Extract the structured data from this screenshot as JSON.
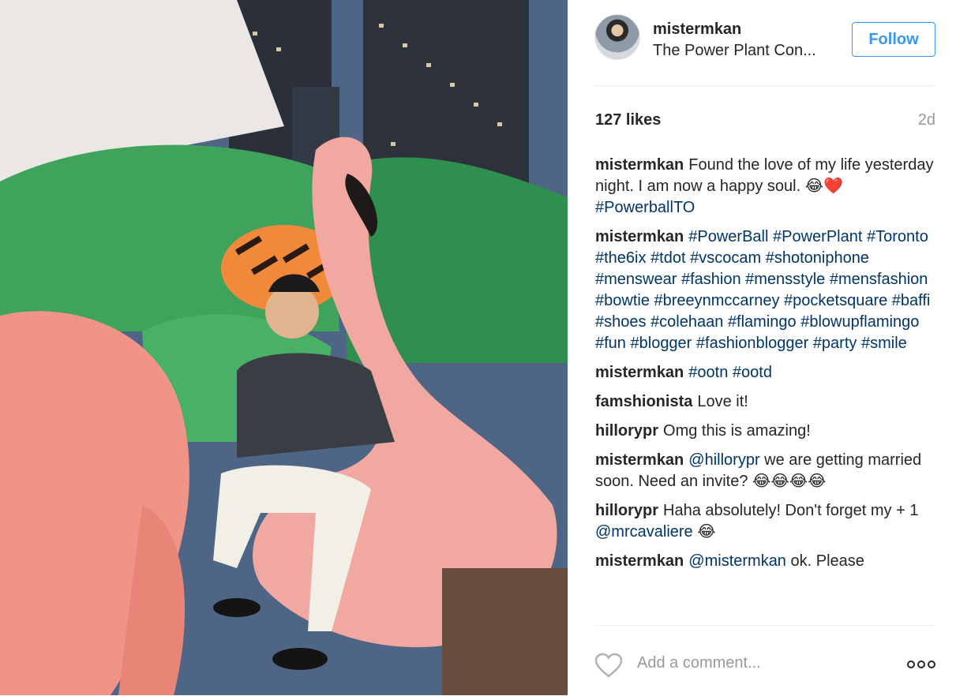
{
  "photo": {
    "alt": "",
    "colors": {
      "flamingo": "#f0a8a0",
      "crocodile": "#3fa35c",
      "tiger": "#f08a3a",
      "sky": "#4e6585"
    }
  },
  "post": {
    "username": "mistermkan",
    "location": "The Power Plant Con...",
    "follow_label": "Follow",
    "likes": "127 likes",
    "age": "2d"
  },
  "comments": [
    {
      "author": "mistermkan",
      "text": "Found the love of my life yesterday night. I am now a happy soul. 😂❤️ ",
      "tags": [
        "#PowerballTO"
      ]
    },
    {
      "author": "mistermkan",
      "text": "",
      "tags": [
        "#PowerBall",
        "#PowerPlant",
        "#Toronto",
        "#the6ix",
        "#tdot",
        "#vscocam",
        "#shotoniphone",
        "#menswear",
        "#fashion",
        "#mensstyle",
        "#mensfashion",
        "#bowtie",
        "#breeynmccarney",
        "#pocketsquare",
        "#baffi",
        "#shoes",
        "#colehaan",
        "#flamingo",
        "#blowupflamingo",
        "#fun",
        "#blogger",
        "#fashionblogger",
        "#party",
        "#smile"
      ]
    },
    {
      "author": "mistermkan",
      "text": "",
      "tags": [
        "#ootn",
        "#ootd"
      ]
    },
    {
      "author": "famshionista",
      "text": "Love it!",
      "tags": []
    },
    {
      "author": "hillorypr",
      "text": "Omg this is amazing!",
      "tags": []
    },
    {
      "author": "mistermkan",
      "mention": "@hillorypr",
      "text": " we are getting married soon. Need an invite? 😂😂😂😂",
      "tags": []
    },
    {
      "author": "hillorypr",
      "text": "Haha absolutely! Don't forget my + 1 ",
      "mention_after": "@mrcavaliere",
      "text_after": " 😂",
      "tags": []
    },
    {
      "author": "mistermkan",
      "mention": "@mistermkan",
      "text": " ok. Please",
      "tags": []
    }
  ],
  "footer": {
    "add_comment_placeholder": "Add a comment...",
    "like_icon": "heart-outline-icon",
    "more_icon": "ellipsis-icon"
  }
}
